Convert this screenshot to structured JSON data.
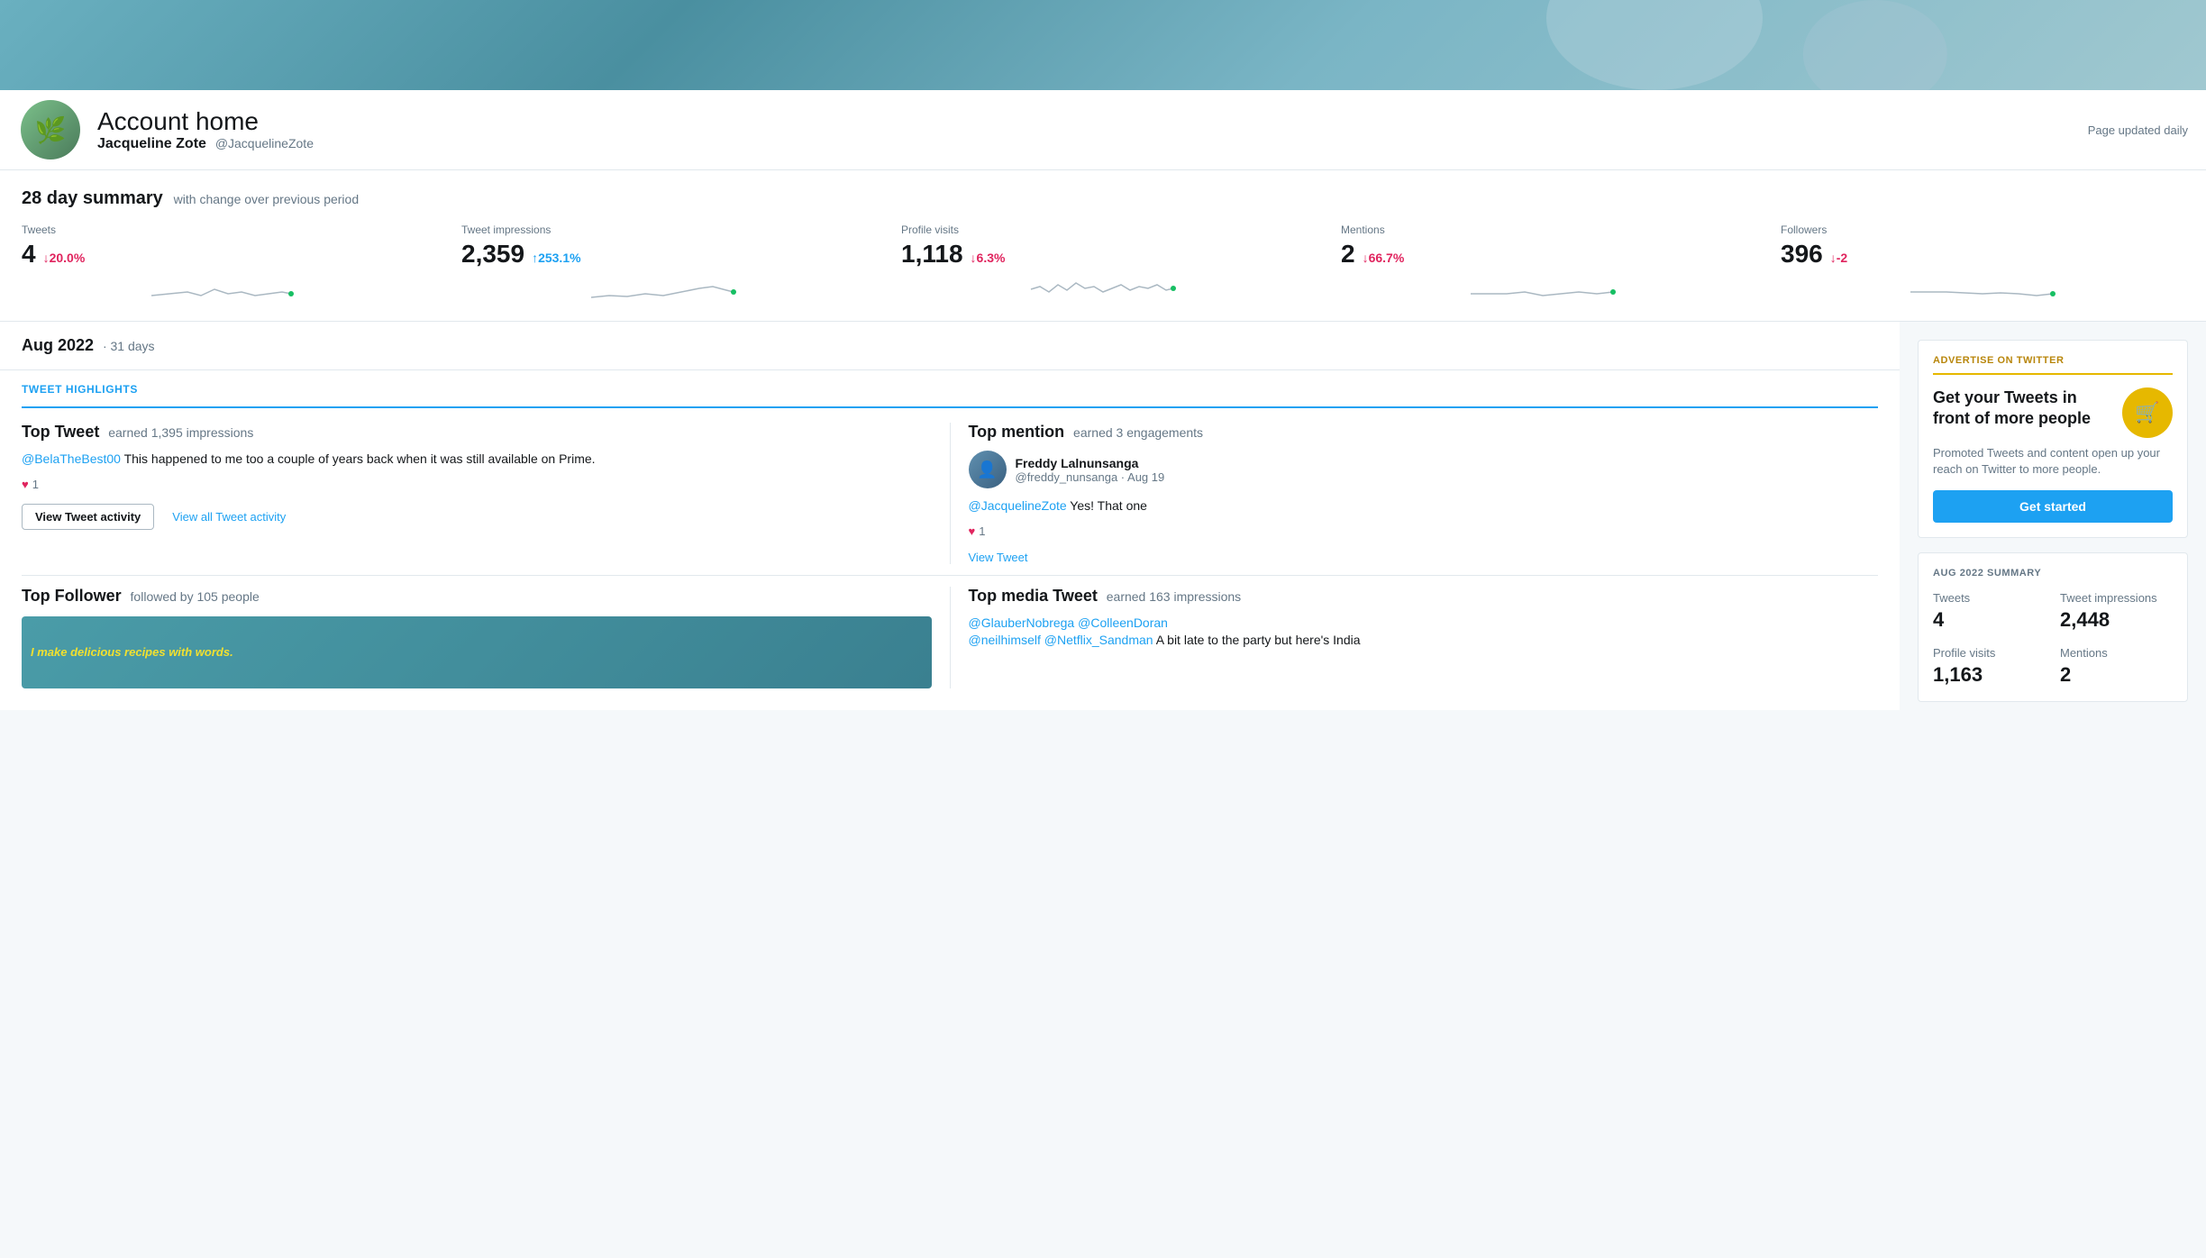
{
  "header": {
    "banner_alt": "Profile banner",
    "page_title": "Account home",
    "account_name": "Jacqueline Zote",
    "account_handle": "@JacquelineZote",
    "page_updated": "Page updated daily"
  },
  "summary": {
    "title": "28 day summary",
    "subtitle": "with change over previous period",
    "metrics": [
      {
        "label": "Tweets",
        "value": "4",
        "change": "↓20.0%",
        "change_type": "down"
      },
      {
        "label": "Tweet impressions",
        "value": "2,359",
        "change": "↑253.1%",
        "change_type": "up"
      },
      {
        "label": "Profile visits",
        "value": "1,118",
        "change": "↓6.3%",
        "change_type": "down"
      },
      {
        "label": "Mentions",
        "value": "2",
        "change": "↓66.7%",
        "change_type": "down"
      },
      {
        "label": "Followers",
        "value": "396",
        "change": "↓-2",
        "change_type": "down"
      }
    ]
  },
  "period": {
    "title": "Aug 2022",
    "days": "31 days"
  },
  "highlights": {
    "section_label": "TWEET HIGHLIGHTS",
    "top_tweet": {
      "heading": "Top Tweet",
      "subtext": "earned 1,395 impressions",
      "mention": "@BelaTheBest00",
      "tweet_text": " This happened to me too a couple of years back when it was still available on Prime.",
      "likes": "1",
      "btn_view_activity": "View Tweet activity",
      "btn_view_all": "View all Tweet activity"
    },
    "top_mention": {
      "heading": "Top mention",
      "subtext": "earned 3 engagements",
      "user_name": "Freddy Lalnunsanga",
      "user_handle": "@freddy_nunsanga",
      "user_date": "Aug 19",
      "mention_link": "@JacquelineZote",
      "mention_text": " Yes! That one",
      "likes": "1",
      "btn_view_tweet": "View Tweet"
    }
  },
  "top_follower": {
    "heading": "Top Follower",
    "subtext": "followed by 105 people",
    "banner_text": "I make delicious recipes with words."
  },
  "top_media_tweet": {
    "heading": "Top media Tweet",
    "subtext": "earned 163 impressions",
    "links": [
      "@GlauberNobrega",
      "@ColleenDoran",
      "@neilhimself",
      "@Netflix_Sandman"
    ],
    "tweet_text": " A bit late to the party but here's India"
  },
  "advertise": {
    "section_label": "ADVERTISE ON TWITTER",
    "title": "Get your Tweets in front of more people",
    "description": "Promoted Tweets and content open up your reach on Twitter to more people.",
    "btn_label": "Get started",
    "icon": "🛒"
  },
  "aug_summary": {
    "section_label": "AUG 2022 SUMMARY",
    "stats": [
      {
        "label": "Tweets",
        "value": "4"
      },
      {
        "label": "Tweet impressions",
        "value": "2,448"
      },
      {
        "label": "Profile visits",
        "value": "1,163"
      },
      {
        "label": "Mentions",
        "value": "2"
      }
    ]
  }
}
